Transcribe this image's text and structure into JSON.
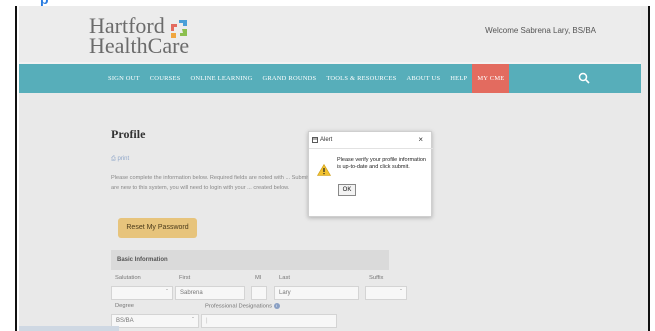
{
  "header": {
    "logo_line1": "Hartford",
    "logo_line2": "HealthCare",
    "welcome": "Welcome Sabrena Lary, BS/BA"
  },
  "nav": {
    "items": [
      {
        "label": "SIGN OUT"
      },
      {
        "label": "COURSES"
      },
      {
        "label": "ONLINE LEARNING"
      },
      {
        "label": "GRAND ROUNDS"
      },
      {
        "label": "TOOLS & RESOURCES"
      },
      {
        "label": "ABOUT US"
      },
      {
        "label": "HELP"
      },
      {
        "label": "MY CME"
      }
    ],
    "search_icon": "search-icon"
  },
  "profile": {
    "title": "Profile",
    "print_label": "print",
    "intro": "Please complete the information below. Required fields are noted with ... Submit. If you are new to this system, you will need to login with your ... created below.",
    "reset_button": "Reset My Password",
    "section_title": "Basic Information",
    "salutation_label": "Salutation",
    "first_label": "First",
    "first_value": "Sabrena",
    "mi_label": "MI",
    "last_label": "Last",
    "last_value": "Lary",
    "suffix_label": "Suffix",
    "degree_label": "Degree",
    "degree_value": "BS/BA",
    "designations_label": "Professional Designations"
  },
  "dialog": {
    "title": "Alert",
    "close": "×",
    "message": "Please verify your profile information is up-to-date and click submit.",
    "ok": "OK"
  },
  "colors": {
    "nav_bg": "#57aeba",
    "nav_active": "#e36b5f",
    "reset_button": "#e7c47c"
  }
}
